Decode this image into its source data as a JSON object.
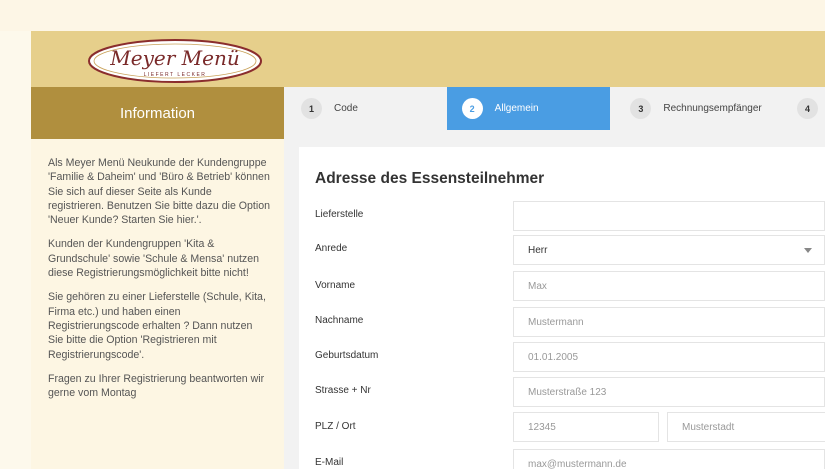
{
  "brand": {
    "logo_text": "Meyer Menü",
    "logo_tagline": "LIEFERT LECKER"
  },
  "sidebar": {
    "title": "Information",
    "paragraphs": [
      "Als Meyer Menü Neukunde der Kundengruppe 'Familie & Daheim' und 'Büro & Betrieb' können Sie sich auf dieser Seite als Kunde registrieren. Benutzen Sie bitte dazu die Option 'Neuer Kunde? Starten Sie hier.'.",
      "Kunden der Kundengruppen 'Kita & Grundschule' sowie 'Schule & Mensa' nutzen diese Registrierungsmöglichkeit bitte nicht!",
      "Sie gehören zu einer Lieferstelle (Schule, Kita, Firma etc.) und haben einen Registrierungscode erhalten ? Dann nutzen Sie bitte die Option 'Registrieren mit Registrierungscode'.",
      "Fragen zu Ihrer Registrierung beantworten wir gerne vom Montag"
    ]
  },
  "steps": [
    {
      "num": "1",
      "label": "Code"
    },
    {
      "num": "2",
      "label": "Allgemein"
    },
    {
      "num": "3",
      "label": "Rechnungsempfänger"
    },
    {
      "num": "4",
      "label": ""
    }
  ],
  "form": {
    "title": "Adresse des Essensteilnehmer",
    "fields": {
      "lieferstelle": {
        "label": "Lieferstelle",
        "value": ""
      },
      "anrede": {
        "label": "Anrede",
        "value": "Herr"
      },
      "vorname": {
        "label": "Vorname",
        "placeholder": "Max"
      },
      "nachname": {
        "label": "Nachname",
        "placeholder": "Mustermann"
      },
      "geburtsdatum": {
        "label": "Geburtsdatum",
        "placeholder": "01.01.2005"
      },
      "strasse": {
        "label": "Strasse + Nr",
        "placeholder": "Musterstraße 123"
      },
      "plz_ort": {
        "label": "PLZ / Ort",
        "plz_placeholder": "12345",
        "ort_placeholder": "Musterstadt"
      },
      "email": {
        "label": "E-Mail",
        "placeholder": "max@mustermann.de"
      }
    }
  },
  "colors": {
    "header": "#e6cf8b",
    "sidebar_head": "#b08f3e",
    "active_step": "#4a9de3"
  }
}
